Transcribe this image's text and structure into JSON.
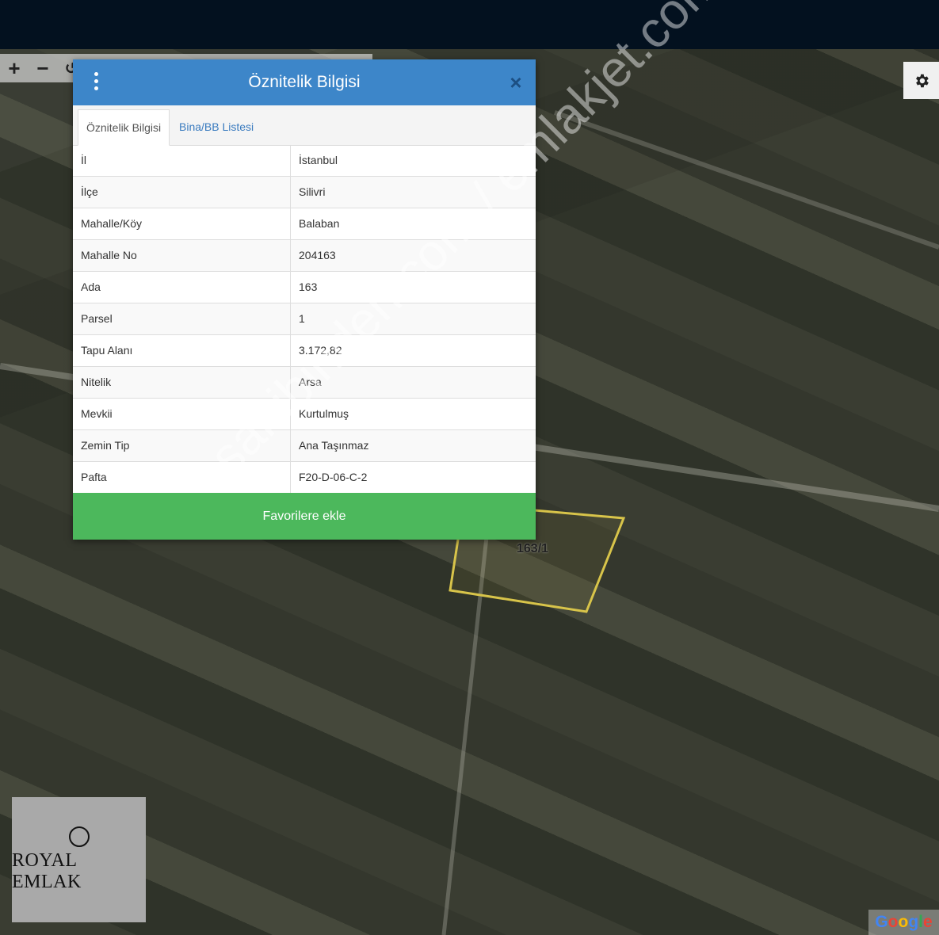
{
  "map": {
    "parcel_label": "163/1",
    "watermark": "sahibinden.com / emlakjet.com"
  },
  "controls": {
    "zoom_in": "+",
    "zoom_out": "−",
    "rotate": "↺",
    "settings_icon": "gear-icon"
  },
  "dialog": {
    "title": "Öznitelik Bilgisi",
    "close_label": "×",
    "tabs": [
      {
        "label": "Öznitelik Bilgisi",
        "active": true
      },
      {
        "label": "Bina/BB Listesi",
        "active": false
      }
    ],
    "rows": [
      {
        "key": "İl",
        "value": "İstanbul"
      },
      {
        "key": "İlçe",
        "value": "Silivri"
      },
      {
        "key": "Mahalle/Köy",
        "value": "Balaban"
      },
      {
        "key": "Mahalle No",
        "value": "204163"
      },
      {
        "key": "Ada",
        "value": "163"
      },
      {
        "key": "Parsel",
        "value": "1"
      },
      {
        "key": "Tapu Alanı",
        "value": "3.172,82"
      },
      {
        "key": "Nitelik",
        "value": "Arsa"
      },
      {
        "key": "Mevkii",
        "value": "Kurtulmuş"
      },
      {
        "key": "Zemin Tip",
        "value": "Ana Taşınmaz"
      },
      {
        "key": "Pafta",
        "value": "F20-D-06-C-2"
      }
    ],
    "favorite_button": "Favorilere ekle"
  },
  "logo": {
    "text": "ROYAL EMLAK"
  },
  "attribution": {
    "letters": [
      "G",
      "o",
      "o",
      "g",
      "l",
      "e"
    ]
  },
  "colors": {
    "header": "#3d86c9",
    "favorite": "#4cb85c",
    "parcel_outline": "#d8c44a"
  }
}
